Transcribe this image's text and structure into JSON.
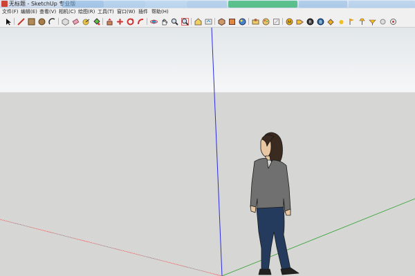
{
  "window": {
    "title": "无标题 - SketchUp 专业版"
  },
  "menu": {
    "items": [
      {
        "label": "文件(F)"
      },
      {
        "label": "编辑(E)"
      },
      {
        "label": "查看(V)"
      },
      {
        "label": "相机(C)"
      },
      {
        "label": "绘图(R)"
      },
      {
        "label": "工具(T)"
      },
      {
        "label": "窗口(W)"
      },
      {
        "label": "插件"
      },
      {
        "label": "帮助(H)"
      }
    ]
  },
  "toolbar": {
    "tools": [
      {
        "icon": "select-icon"
      },
      {
        "icon": "line-icon"
      },
      {
        "icon": "rectangle-icon"
      },
      {
        "icon": "circle-icon"
      },
      {
        "icon": "arc-icon"
      },
      {
        "icon": "make-component-icon"
      },
      {
        "icon": "eraser-icon"
      },
      {
        "icon": "tape-measure-icon"
      },
      {
        "icon": "paint-bucket-icon"
      },
      {
        "icon": "push-pull-icon"
      },
      {
        "icon": "move-icon"
      },
      {
        "icon": "rotate-icon"
      },
      {
        "icon": "follow-me-icon"
      },
      {
        "icon": "orbit-icon"
      },
      {
        "icon": "pan-icon"
      },
      {
        "icon": "zoom-icon"
      },
      {
        "icon": "zoom-extents-icon"
      },
      {
        "icon": "warehouse-icon"
      },
      {
        "icon": "share-model-icon"
      },
      {
        "icon": "components-icon"
      },
      {
        "icon": "extension-warehouse-icon"
      },
      {
        "icon": "sandbox-icon"
      },
      {
        "icon": "section-plane-icon"
      },
      {
        "icon": "styles-icon"
      },
      {
        "icon": "materials-icon"
      },
      {
        "icon": "plugin-m-icon"
      },
      {
        "icon": "plugin-tag-icon"
      },
      {
        "icon": "plugin-r-icon"
      },
      {
        "icon": "plugin-b-icon"
      },
      {
        "icon": "plugin-hammer-icon"
      },
      {
        "icon": "sphere-icon"
      },
      {
        "icon": "flag-icon"
      },
      {
        "icon": "lamp-icon"
      },
      {
        "icon": "bulb-icon"
      },
      {
        "icon": "ball-icon"
      },
      {
        "icon": "render-icon"
      }
    ]
  },
  "colors": {
    "sky_top": "#e2e7ea",
    "ground": "#d6d6d4",
    "axis_blue": "#2a2ae0",
    "axis_red": "#d04040",
    "axis_green": "#2aa02a"
  }
}
